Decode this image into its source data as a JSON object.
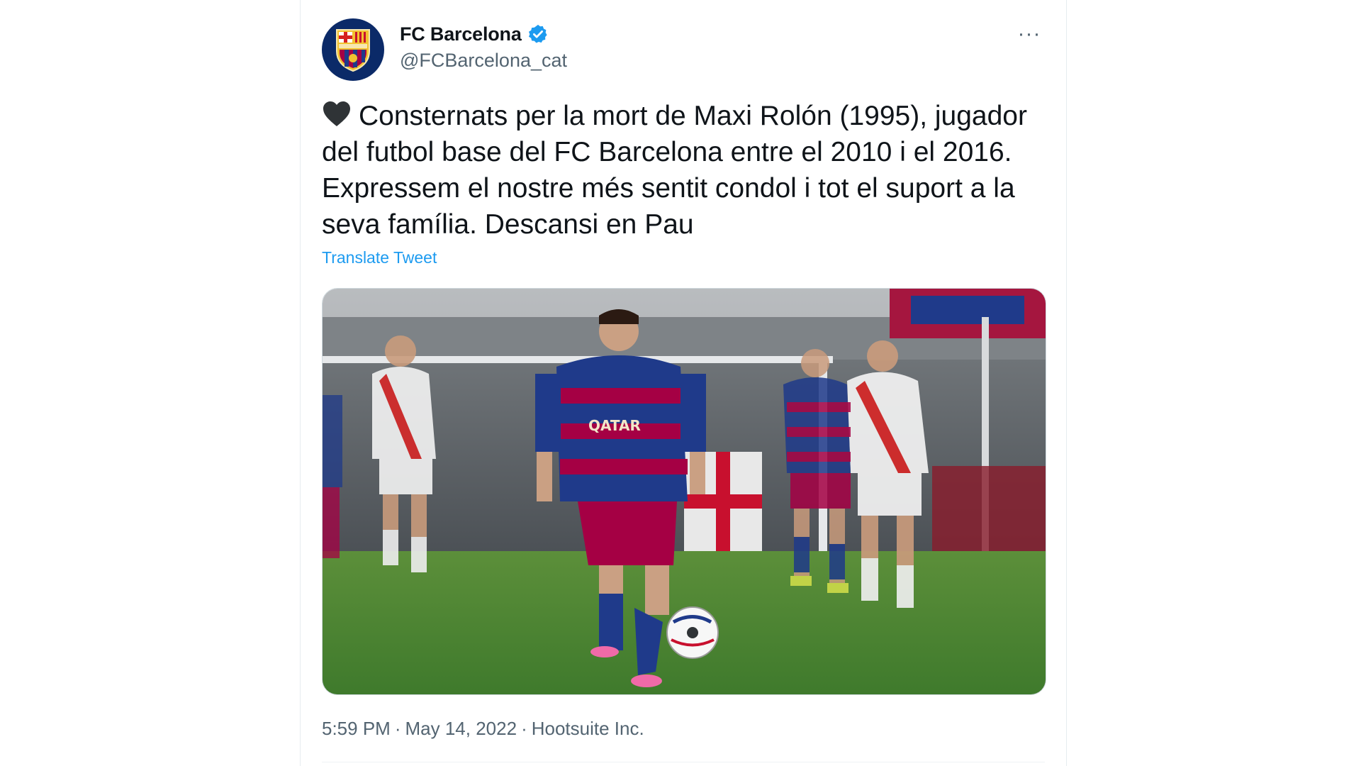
{
  "author": {
    "display_name": "FC Barcelona",
    "handle": "@FCBarcelona_cat",
    "verified": true,
    "avatar_icon": "fc-barcelona-crest-icon"
  },
  "more_label": "···",
  "tweet": {
    "emoji": "black-heart-icon",
    "text": "Consternats per la mort de Maxi Rolón (1995), jugador del futbol base del FC Barcelona entre el 2010 i el 2016. Expressem el nostre més sentit condol i tot el suport a la seva família. Descansi en Pau",
    "translate_label": "Translate Tweet"
  },
  "media": {
    "jersey_text": "QATAR"
  },
  "meta": {
    "time": "5:59 PM",
    "separator": "·",
    "date": "May 14, 2022",
    "source": "Hootsuite Inc."
  },
  "colors": {
    "link": "#1d9bf0",
    "secondary_text": "#536471",
    "verified": "#1d9bf0",
    "barca_blue": "#1f3a8a",
    "barca_garnet": "#a50044"
  }
}
